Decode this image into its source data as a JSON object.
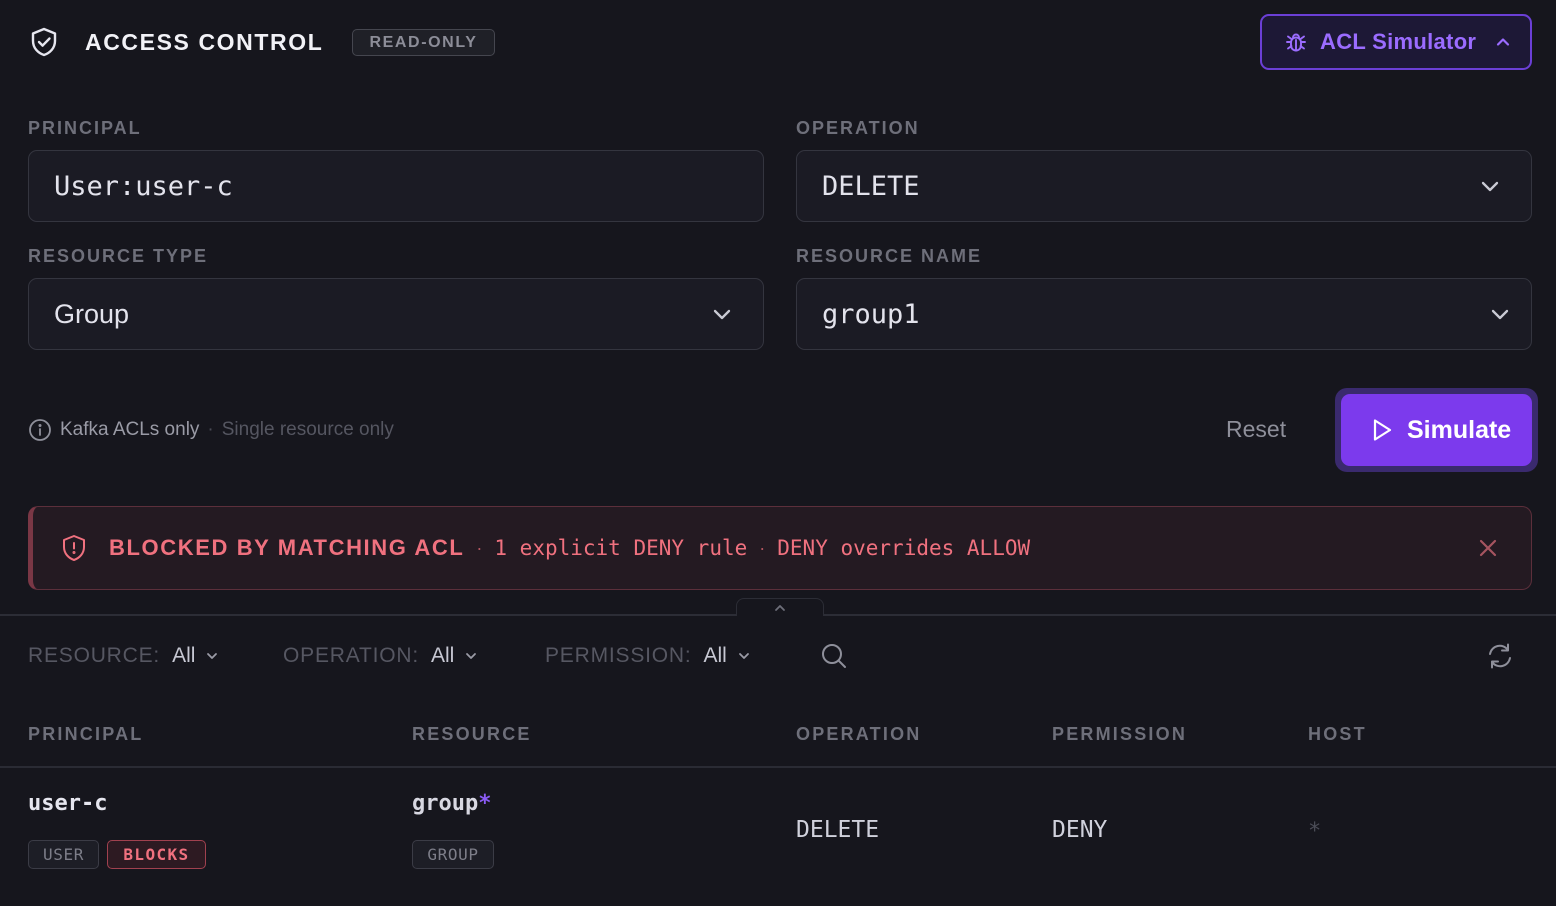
{
  "header": {
    "title": "ACCESS CONTROL",
    "badge": "READ-ONLY",
    "simulator_toggle": "ACL Simulator"
  },
  "form": {
    "principal_label": "PRINCIPAL",
    "principal_value": "User:user-c",
    "operation_label": "OPERATION",
    "operation_value": "DELETE",
    "resource_type_label": "RESOURCE TYPE",
    "resource_type_value": "Group",
    "resource_name_label": "RESOURCE NAME",
    "resource_name_value": "group1"
  },
  "info": {
    "primary": "Kafka ACLs only",
    "separator": "·",
    "secondary": "Single resource only"
  },
  "actions": {
    "reset": "Reset",
    "simulate": "Simulate"
  },
  "alert": {
    "title": "BLOCKED BY MATCHING ACL",
    "separator": "·",
    "detail_1": "1 explicit DENY rule",
    "detail_2": "DENY overrides ALLOW"
  },
  "filters": {
    "resource_key": "RESOURCE:",
    "resource_value": "All",
    "operation_key": "OPERATION:",
    "operation_value": "All",
    "permission_key": "PERMISSION:",
    "permission_value": "All"
  },
  "table": {
    "columns": [
      "PRINCIPAL",
      "RESOURCE",
      "OPERATION",
      "PERMISSION",
      "HOST"
    ],
    "rows": [
      {
        "principal": "user-c",
        "principal_type": "USER",
        "principal_tag": "BLOCKS",
        "resource": "group",
        "resource_wildcard": "*",
        "resource_type": "GROUP",
        "operation": "DELETE",
        "permission": "DENY",
        "host": "*"
      }
    ]
  },
  "colors": {
    "background": "#16161d",
    "accent": "#7c3aed",
    "danger": "#f0717f"
  },
  "icons": {
    "header": "shield-check-icon",
    "simulator": "bug-icon",
    "simulate": "play-icon",
    "info": "info-icon",
    "alert": "shield-alert-icon",
    "close": "close-icon",
    "search": "search-icon",
    "refresh": "refresh-icon"
  }
}
